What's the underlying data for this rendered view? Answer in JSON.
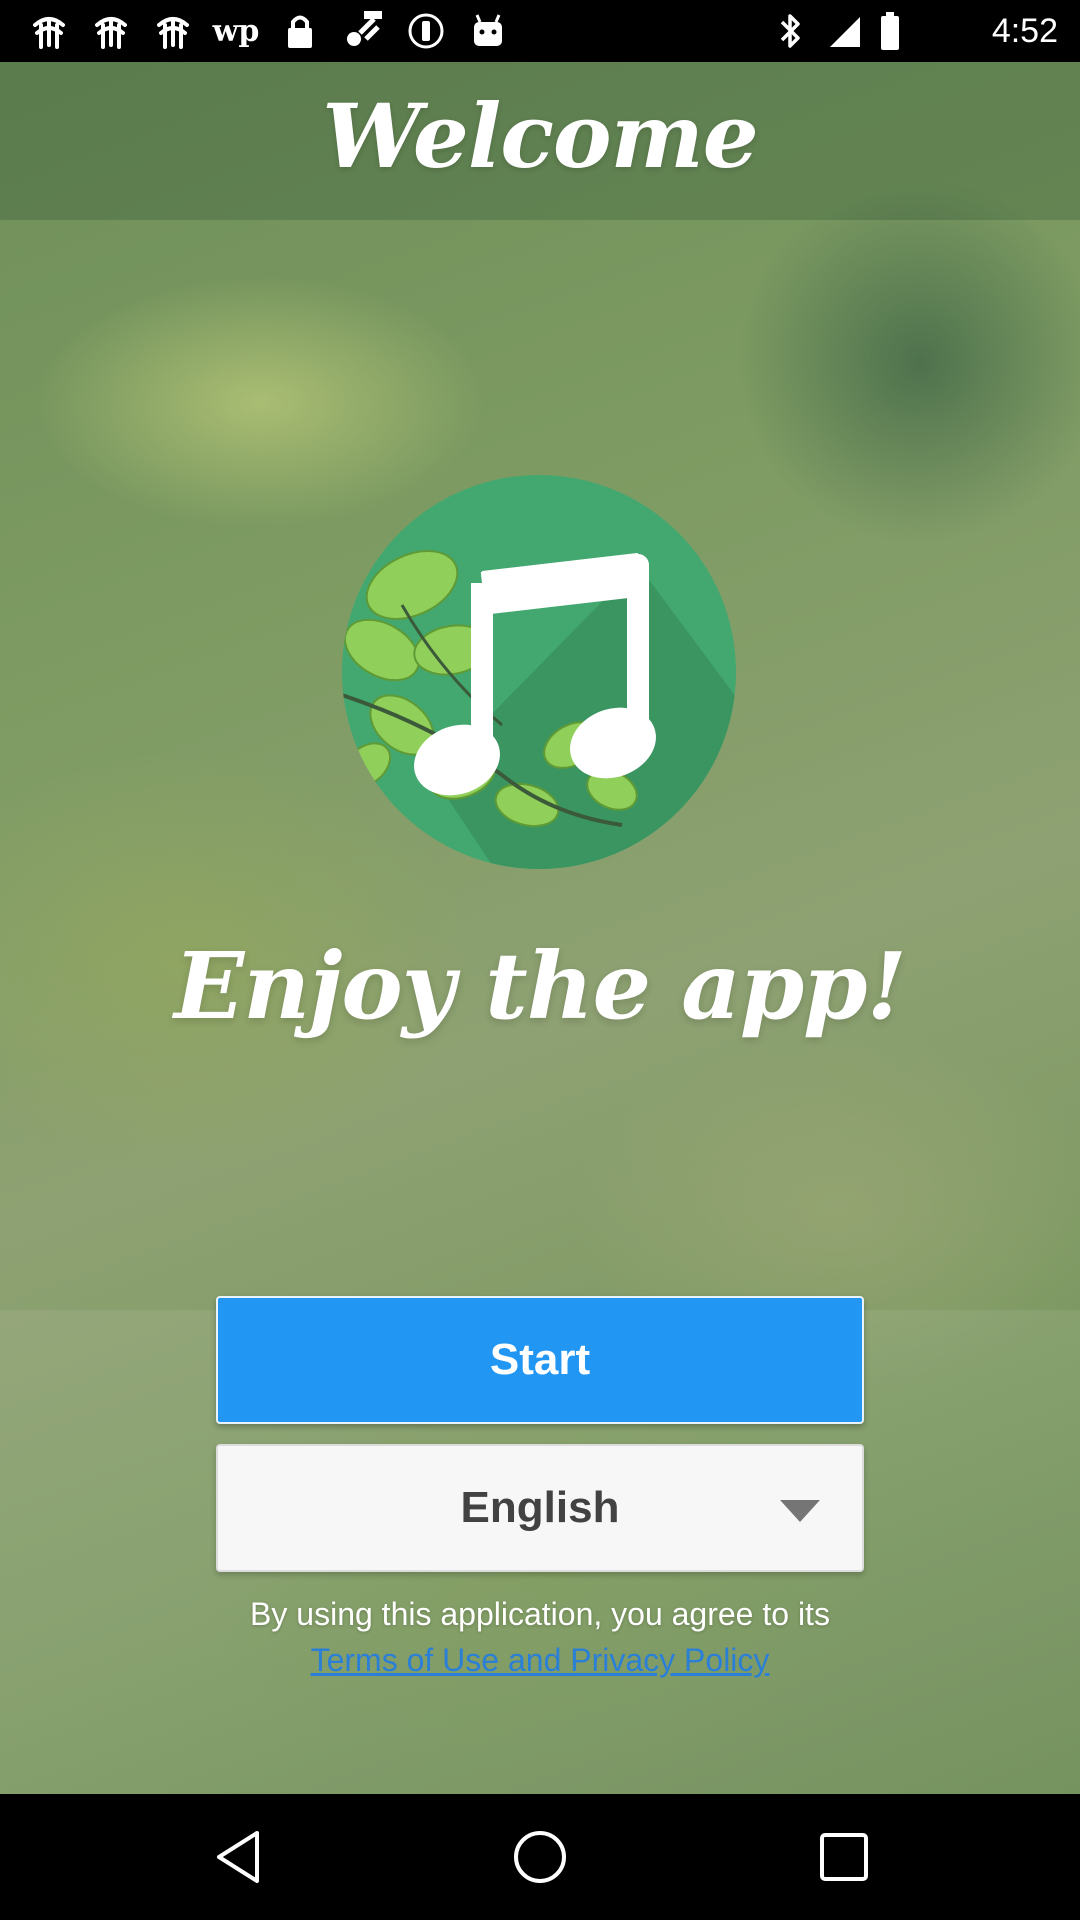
{
  "status_bar": {
    "time": "4:52",
    "notification_icons": [
      "notification-icon",
      "notification-icon",
      "notification-icon",
      "wp-icon",
      "lock-icon",
      "fake-gps-icon",
      "info-icon",
      "android-icon"
    ],
    "wp_label": "wp",
    "system_icons": [
      "bluetooth-icon"
    ]
  },
  "welcome": {
    "title": "Welcome"
  },
  "logo": {
    "icon": "music-note-icon",
    "colors": {
      "circle": "#43a870",
      "shadow": "#3a9561",
      "leaf": "#8fcf5a",
      "note": "#ffffff"
    }
  },
  "tagline": "Enjoy the app!",
  "start_button": {
    "label": "Start",
    "color": "#2196f3"
  },
  "language_select": {
    "selected": "English",
    "icon": "chevron-down-icon"
  },
  "legal": {
    "agree_text": "By using this application, you agree to its",
    "terms_link": "Terms of Use and Privacy Policy"
  },
  "nav_bar": {
    "back_icon": "back-icon",
    "home_icon": "home-icon",
    "recents_icon": "recents-icon"
  }
}
